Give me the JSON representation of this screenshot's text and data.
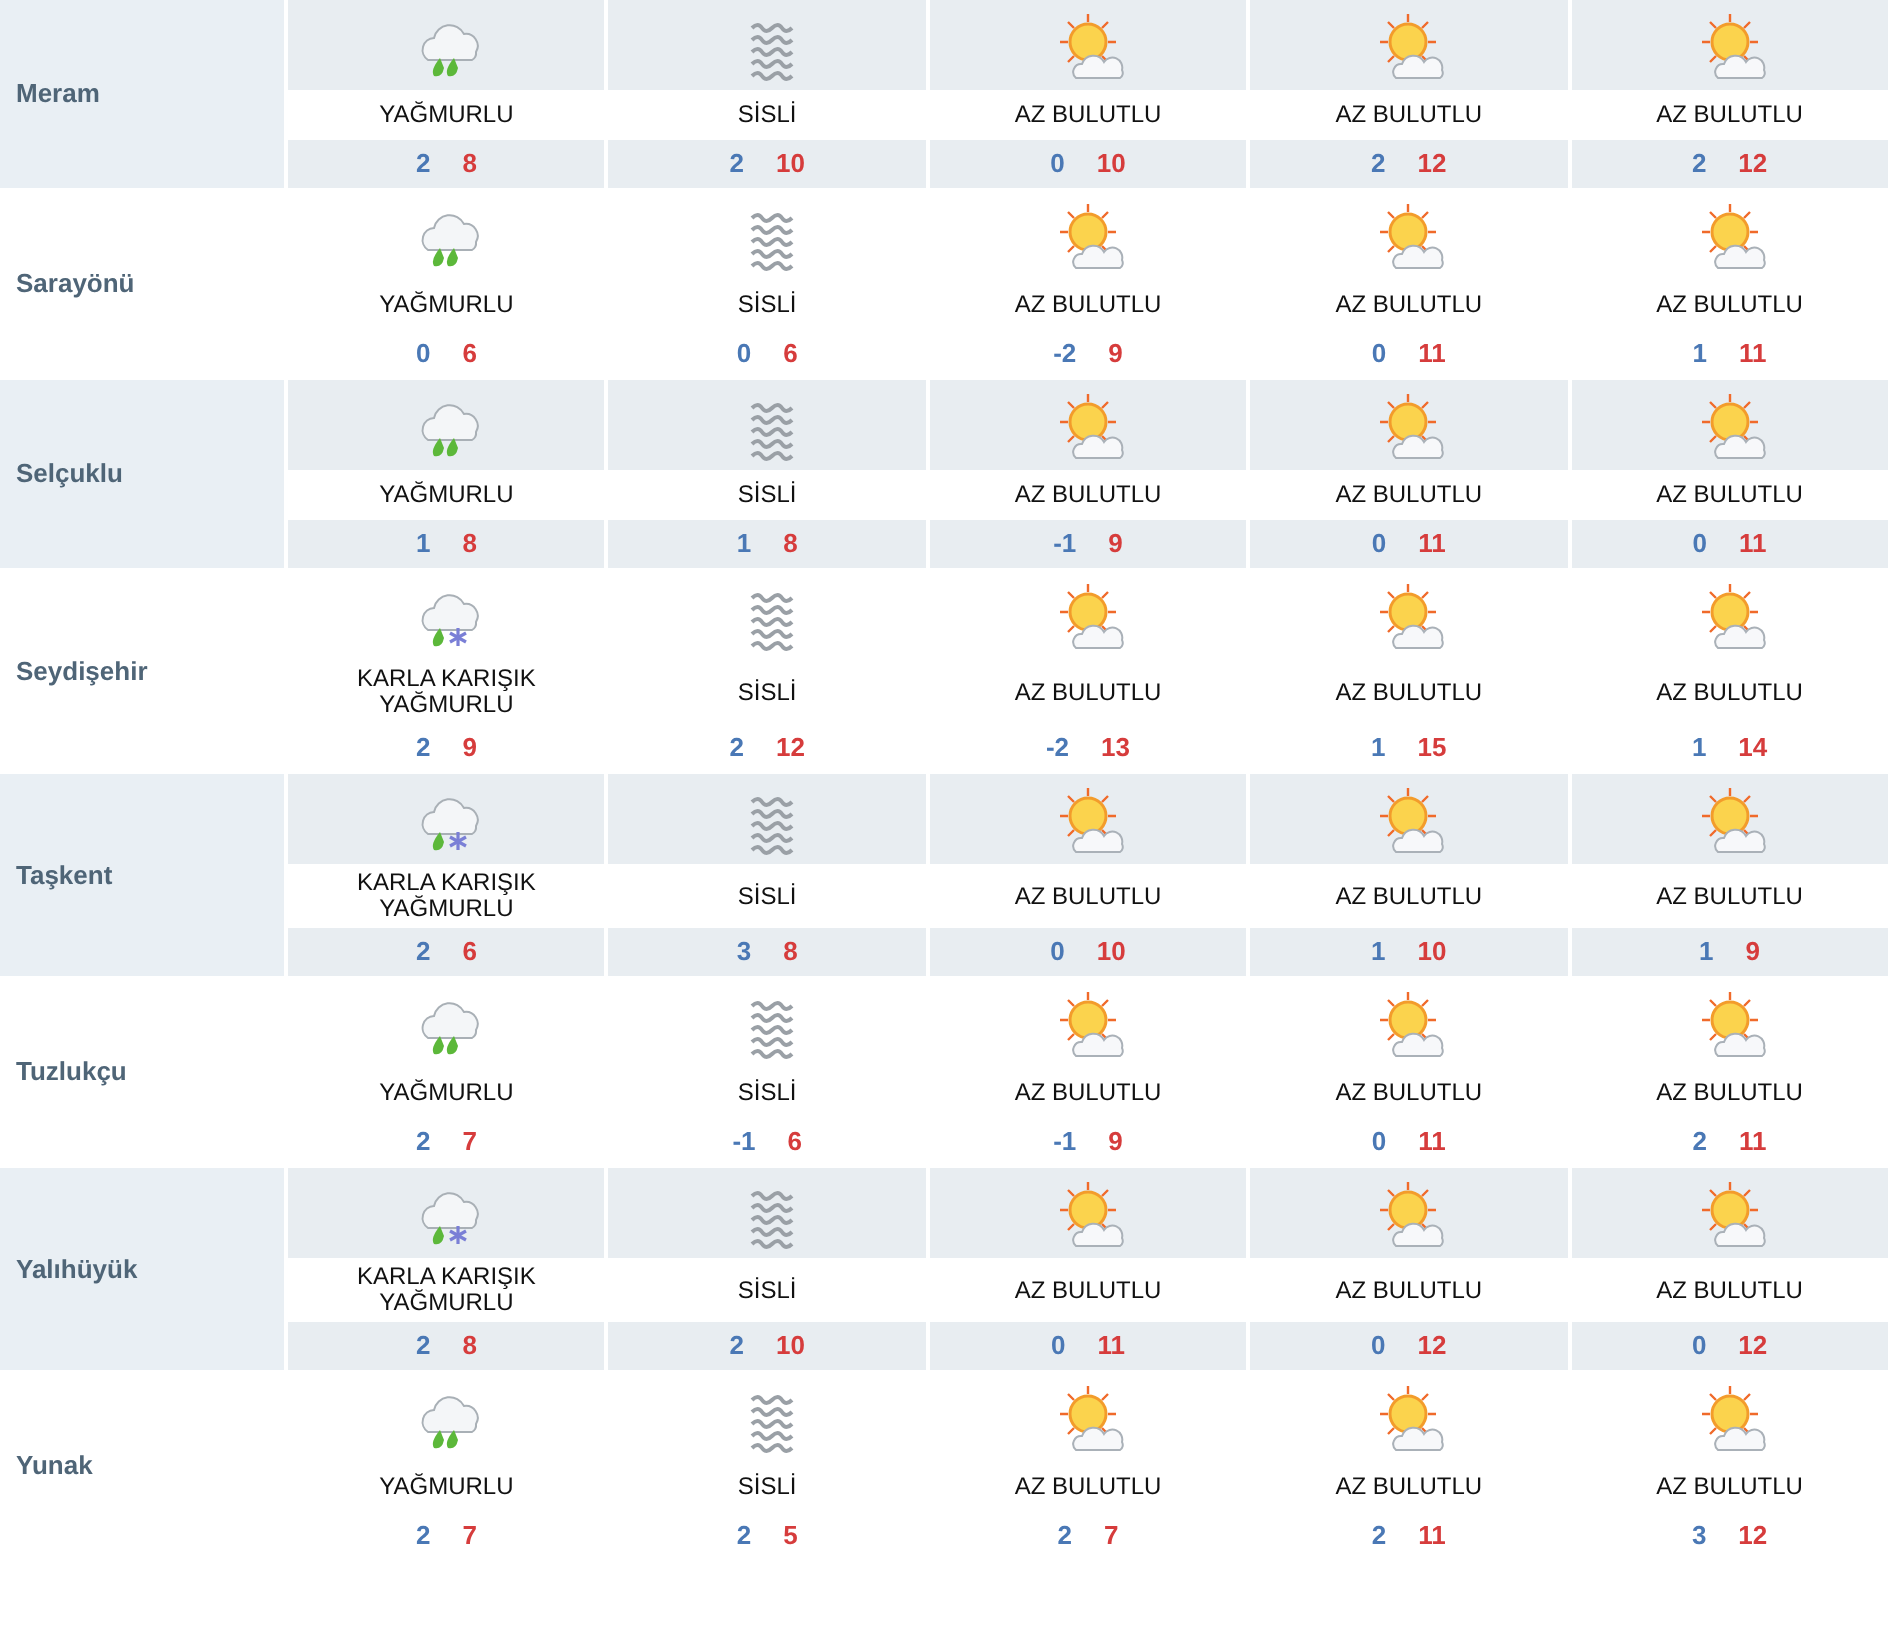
{
  "forecast": [
    {
      "city": "Meram",
      "days": [
        {
          "kind": "rain",
          "condition": "YAĞMURLU",
          "low": "2",
          "high": "8"
        },
        {
          "kind": "fog",
          "condition": "SİSLİ",
          "low": "2",
          "high": "10"
        },
        {
          "kind": "partly_cloudy",
          "condition": "AZ BULUTLU",
          "low": "0",
          "high": "10"
        },
        {
          "kind": "partly_cloudy",
          "condition": "AZ BULUTLU",
          "low": "2",
          "high": "12"
        },
        {
          "kind": "partly_cloudy",
          "condition": "AZ BULUTLU",
          "low": "2",
          "high": "12"
        }
      ]
    },
    {
      "city": "Sarayönü",
      "days": [
        {
          "kind": "rain",
          "condition": "YAĞMURLU",
          "low": "0",
          "high": "6"
        },
        {
          "kind": "fog",
          "condition": "SİSLİ",
          "low": "0",
          "high": "6"
        },
        {
          "kind": "partly_cloudy",
          "condition": "AZ BULUTLU",
          "low": "-2",
          "high": "9"
        },
        {
          "kind": "partly_cloudy",
          "condition": "AZ BULUTLU",
          "low": "0",
          "high": "11"
        },
        {
          "kind": "partly_cloudy",
          "condition": "AZ BULUTLU",
          "low": "1",
          "high": "11"
        }
      ]
    },
    {
      "city": "Selçuklu",
      "days": [
        {
          "kind": "rain",
          "condition": "YAĞMURLU",
          "low": "1",
          "high": "8"
        },
        {
          "kind": "fog",
          "condition": "SİSLİ",
          "low": "1",
          "high": "8"
        },
        {
          "kind": "partly_cloudy",
          "condition": "AZ BULUTLU",
          "low": "-1",
          "high": "9"
        },
        {
          "kind": "partly_cloudy",
          "condition": "AZ BULUTLU",
          "low": "0",
          "high": "11"
        },
        {
          "kind": "partly_cloudy",
          "condition": "AZ BULUTLU",
          "low": "0",
          "high": "11"
        }
      ]
    },
    {
      "city": "Seydişehir",
      "days": [
        {
          "kind": "sleet",
          "condition": "KARLA KARIŞIK YAĞMURLU",
          "low": "2",
          "high": "9"
        },
        {
          "kind": "fog",
          "condition": "SİSLİ",
          "low": "2",
          "high": "12"
        },
        {
          "kind": "partly_cloudy",
          "condition": "AZ BULUTLU",
          "low": "-2",
          "high": "13"
        },
        {
          "kind": "partly_cloudy",
          "condition": "AZ BULUTLU",
          "low": "1",
          "high": "15"
        },
        {
          "kind": "partly_cloudy",
          "condition": "AZ BULUTLU",
          "low": "1",
          "high": "14"
        }
      ]
    },
    {
      "city": "Taşkent",
      "days": [
        {
          "kind": "sleet",
          "condition": "KARLA KARIŞIK YAĞMURLU",
          "low": "2",
          "high": "6"
        },
        {
          "kind": "fog",
          "condition": "SİSLİ",
          "low": "3",
          "high": "8"
        },
        {
          "kind": "partly_cloudy",
          "condition": "AZ BULUTLU",
          "low": "0",
          "high": "10"
        },
        {
          "kind": "partly_cloudy",
          "condition": "AZ BULUTLU",
          "low": "1",
          "high": "10"
        },
        {
          "kind": "partly_cloudy",
          "condition": "AZ BULUTLU",
          "low": "1",
          "high": "9"
        }
      ]
    },
    {
      "city": "Tuzlukçu",
      "days": [
        {
          "kind": "rain",
          "condition": "YAĞMURLU",
          "low": "2",
          "high": "7"
        },
        {
          "kind": "fog",
          "condition": "SİSLİ",
          "low": "-1",
          "high": "6"
        },
        {
          "kind": "partly_cloudy",
          "condition": "AZ BULUTLU",
          "low": "-1",
          "high": "9"
        },
        {
          "kind": "partly_cloudy",
          "condition": "AZ BULUTLU",
          "low": "0",
          "high": "11"
        },
        {
          "kind": "partly_cloudy",
          "condition": "AZ BULUTLU",
          "low": "2",
          "high": "11"
        }
      ]
    },
    {
      "city": "Yalıhüyük",
      "days": [
        {
          "kind": "sleet",
          "condition": "KARLA KARIŞIK YAĞMURLU",
          "low": "2",
          "high": "8"
        },
        {
          "kind": "fog",
          "condition": "SİSLİ",
          "low": "2",
          "high": "10"
        },
        {
          "kind": "partly_cloudy",
          "condition": "AZ BULUTLU",
          "low": "0",
          "high": "11"
        },
        {
          "kind": "partly_cloudy",
          "condition": "AZ BULUTLU",
          "low": "0",
          "high": "12"
        },
        {
          "kind": "partly_cloudy",
          "condition": "AZ BULUTLU",
          "low": "0",
          "high": "12"
        }
      ]
    },
    {
      "city": "Yunak",
      "days": [
        {
          "kind": "rain",
          "condition": "YAĞMURLU",
          "low": "2",
          "high": "7"
        },
        {
          "kind": "fog",
          "condition": "SİSLİ",
          "low": "2",
          "high": "5"
        },
        {
          "kind": "partly_cloudy",
          "condition": "AZ BULUTLU",
          "low": "2",
          "high": "7"
        },
        {
          "kind": "partly_cloudy",
          "condition": "AZ BULUTLU",
          "low": "2",
          "high": "11"
        },
        {
          "kind": "partly_cloudy",
          "condition": "AZ BULUTLU",
          "low": "3",
          "high": "12"
        }
      ]
    }
  ]
}
